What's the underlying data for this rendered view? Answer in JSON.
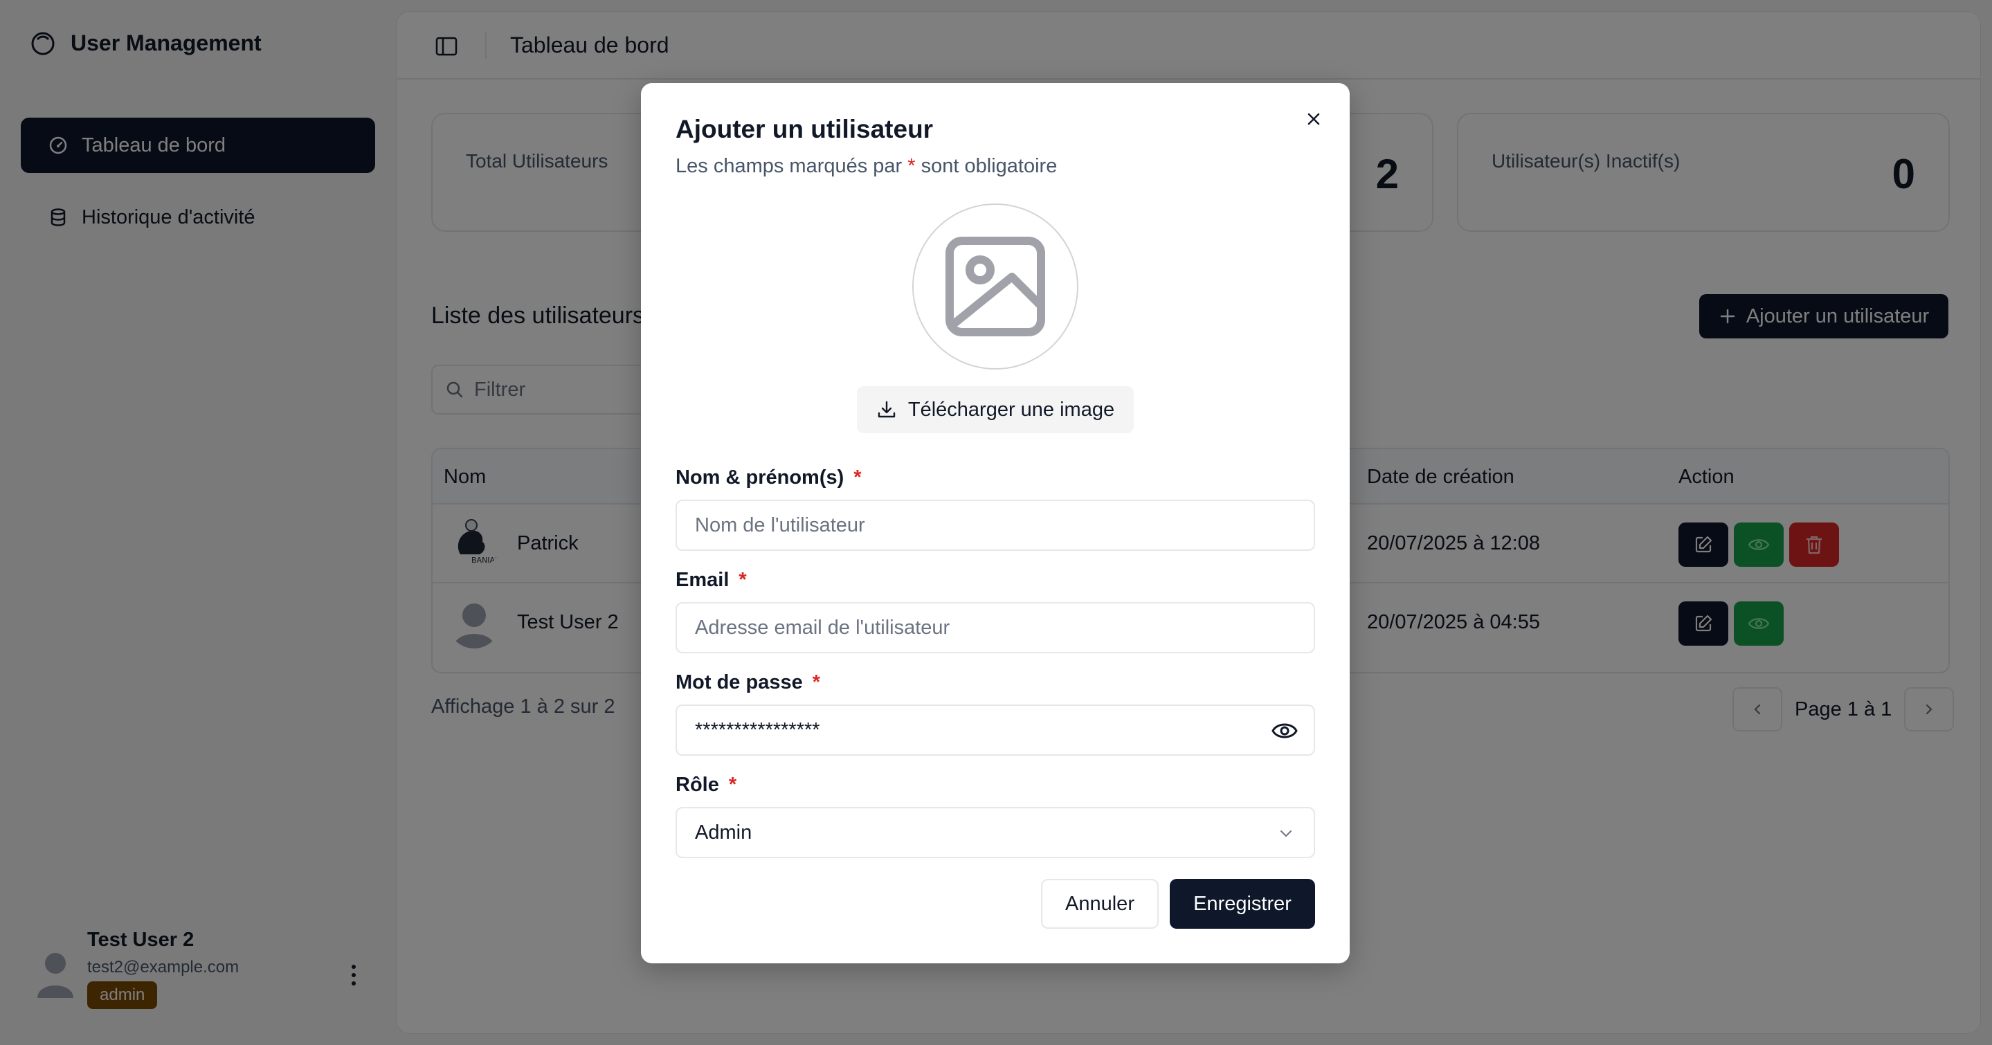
{
  "app": {
    "title": "User Management"
  },
  "sidebar": {
    "items": [
      {
        "label": "Tableau de bord",
        "icon": "dashboard-icon",
        "active": true
      },
      {
        "label": "Historique d'activité",
        "icon": "database-icon",
        "active": false
      }
    ],
    "user": {
      "name": "Test User 2",
      "email": "test2@example.com",
      "role": "admin"
    }
  },
  "header": {
    "breadcrumb": "Tableau de bord"
  },
  "stats": [
    {
      "label": "Total Utilisateurs",
      "value": ""
    },
    {
      "label": "",
      "value": "2"
    },
    {
      "label": "Utilisateur(s) Inactif(s)",
      "value": "0"
    }
  ],
  "users_section": {
    "title": "Liste des utilisateurs",
    "add_button": "Ajouter un utilisateur",
    "filter_placeholder": "Filtrer",
    "columns": {
      "name": "Nom",
      "created": "Date de création",
      "action": "Action"
    },
    "rows": [
      {
        "name": "Patrick",
        "created": "20/07/2025 à 12:08",
        "avatar_text": "BANIAN"
      },
      {
        "name": "Test User 2",
        "created": "20/07/2025 à 04:55"
      }
    ],
    "paging_info": "Affichage 1 à 2 sur 2",
    "page_label": "Page 1 à 1"
  },
  "modal": {
    "title": "Ajouter un utilisateur",
    "subtitle_before": "Les champs marqués par",
    "required_mark": "*",
    "subtitle_after": "sont obligatoire",
    "upload_label": "Télécharger une image",
    "fields": {
      "name": {
        "label": "Nom & prénom(s)",
        "placeholder": "Nom de l'utilisateur"
      },
      "email": {
        "label": "Email",
        "placeholder": "Adresse email de l'utilisateur"
      },
      "password": {
        "label": "Mot de passe",
        "value": "****************"
      },
      "role": {
        "label": "Rôle",
        "value": "Admin"
      }
    },
    "cancel": "Annuler",
    "save": "Enregistrer"
  },
  "colors": {
    "primary": "#0f172a",
    "view": "#16a34a",
    "delete": "#dc2626",
    "role_badge": "#7c4a03",
    "required": "#dc2626"
  }
}
